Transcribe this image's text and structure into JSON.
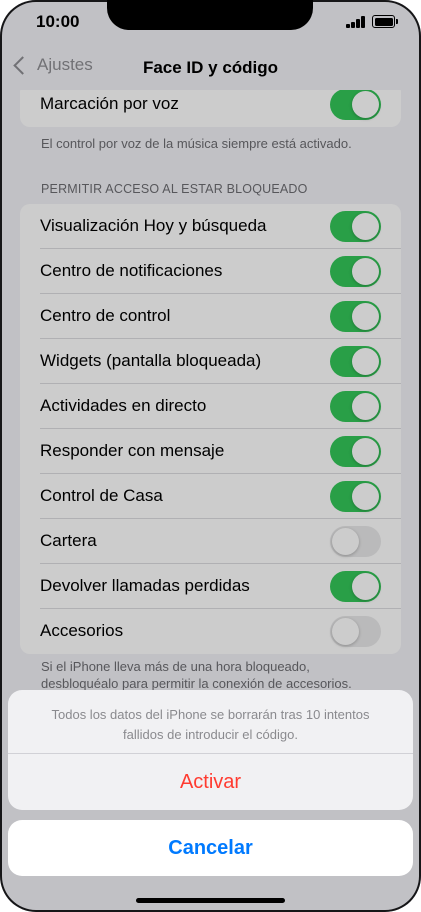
{
  "status": {
    "time": "10:00"
  },
  "nav": {
    "back_label": "Ajustes",
    "title": "Face ID y código"
  },
  "top_group": {
    "items": [
      {
        "label": "Marcación por voz",
        "on": true
      }
    ],
    "footnote": "El control por voz de la música siempre está activado."
  },
  "locked_access": {
    "header": "PERMITIR ACCESO AL ESTAR BLOQUEADO",
    "items": [
      {
        "label": "Visualización Hoy y búsqueda",
        "on": true
      },
      {
        "label": "Centro de notificaciones",
        "on": true
      },
      {
        "label": "Centro de control",
        "on": true
      },
      {
        "label": "Widgets (pantalla bloqueada)",
        "on": true
      },
      {
        "label": "Actividades en directo",
        "on": true
      },
      {
        "label": "Responder con mensaje",
        "on": true
      },
      {
        "label": "Control de Casa",
        "on": true
      },
      {
        "label": "Cartera",
        "on": false
      },
      {
        "label": "Devolver llamadas perdidas",
        "on": true
      },
      {
        "label": "Accesorios",
        "on": false
      }
    ],
    "footnote_line1": "Si el iPhone lleva más de una hora bloqueado,",
    "footnote_line2": "desbloquéalo para permitir la conexión de accesorios."
  },
  "action_sheet": {
    "message_line1": "Todos los datos del iPhone se borrarán tras 10 intentos",
    "message_line2": "fallidos de introducir el código.",
    "action_label": "Activar",
    "cancel_label": "Cancelar"
  },
  "colors": {
    "toggle_on": "#34c759",
    "toggle_off": "#e9e9ea",
    "destructive": "#ff3b30",
    "accent": "#007aff"
  }
}
